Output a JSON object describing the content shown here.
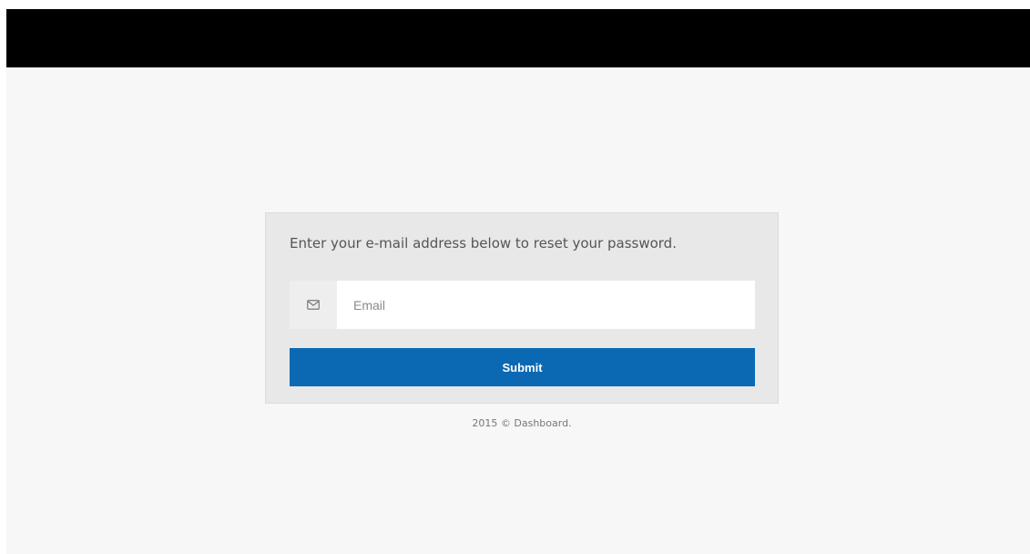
{
  "form": {
    "instructions": "Enter your e-mail address below to reset your password.",
    "email_icon": "envelope-icon",
    "email_placeholder": "Email",
    "email_value": "",
    "submit_label": "Submit"
  },
  "footer": {
    "text": "2015 © Dashboard."
  },
  "colors": {
    "topbar": "#000000",
    "background": "#f7f7f7",
    "card": "#e8e8e8",
    "submit": "#0b69b4"
  }
}
